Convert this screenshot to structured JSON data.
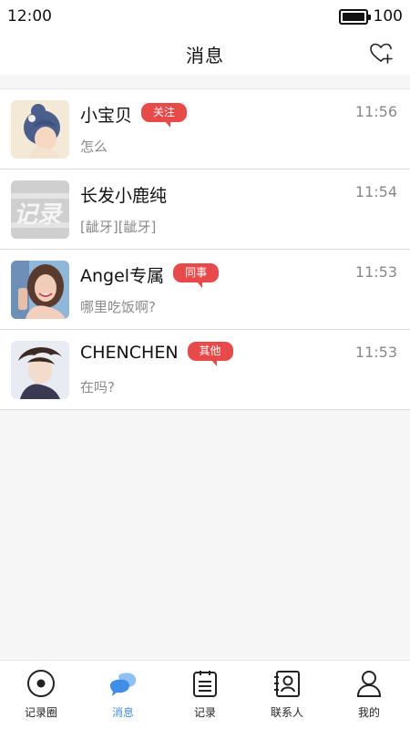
{
  "status_bar": {
    "time": "12:00",
    "battery": "100"
  },
  "header": {
    "title": "消息",
    "action_icon": "heart-plus-icon"
  },
  "conversations": [
    {
      "name": "小宝贝",
      "tag": "关注",
      "time": "11:56",
      "preview": "怎么",
      "avatar": "girl-blue-hair-avatar"
    },
    {
      "name": "长发小鹿纯",
      "tag": "",
      "time": "11:54",
      "preview": "[龇牙][龇牙]",
      "avatar": "logo-placeholder-avatar",
      "avatar_text": "记录"
    },
    {
      "name": "Angel专属",
      "tag": "同事",
      "time": "11:53",
      "preview": "哪里吃饭啊?",
      "avatar": "woman-photo-avatar"
    },
    {
      "name": "CHENCHEN",
      "tag": "其他",
      "time": "11:53",
      "preview": "在吗?",
      "avatar": "illustrated-boy-avatar"
    }
  ],
  "tabs": [
    {
      "label": "记录圈",
      "icon": "eye-circle-icon",
      "active": false
    },
    {
      "label": "消息",
      "icon": "chat-bubbles-icon",
      "active": true
    },
    {
      "label": "记录",
      "icon": "notepad-icon",
      "active": false
    },
    {
      "label": "联系人",
      "icon": "contact-card-icon",
      "active": false
    },
    {
      "label": "我的",
      "icon": "person-icon",
      "active": false
    }
  ],
  "colors": {
    "tag": "#e84a4a",
    "active_tab": "#3f8ee8",
    "background": "#f6f6f6"
  }
}
